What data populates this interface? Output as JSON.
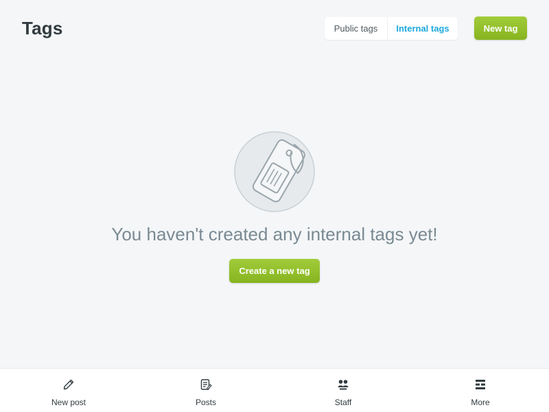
{
  "header": {
    "title": "Tags",
    "tabs": [
      {
        "label": "Public tags",
        "active": false
      },
      {
        "label": "Internal tags",
        "active": true
      }
    ],
    "new_tag_label": "New tag"
  },
  "empty_state": {
    "illustration": "tag-icon",
    "message": "You haven't created any internal tags yet!",
    "button_label": "Create a new tag"
  },
  "bottom_nav": {
    "items": [
      {
        "label": "New post",
        "icon": "pencil-icon"
      },
      {
        "label": "Posts",
        "icon": "posts-icon"
      },
      {
        "label": "Staff",
        "icon": "staff-icon"
      },
      {
        "label": "More",
        "icon": "more-icon"
      }
    ]
  },
  "colors": {
    "accent_green": "#9fc630",
    "active_tab_blue": "#1ca8dd",
    "background": "#f4f6f8"
  }
}
